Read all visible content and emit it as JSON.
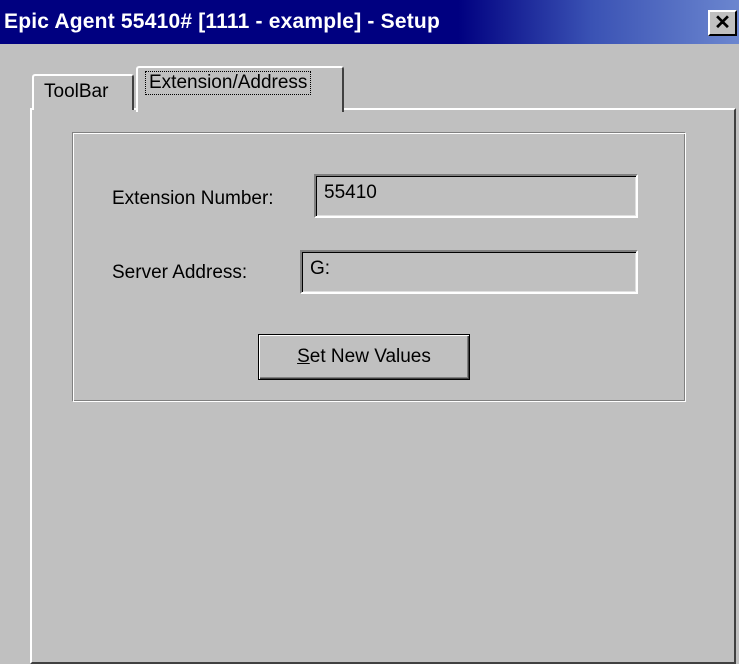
{
  "window": {
    "title": "Epic Agent 55410# [1111 - example] - Setup",
    "close_icon": "close-icon",
    "colors": {
      "titlebar": "#000080",
      "face": "#c0c0c0"
    }
  },
  "tabs": [
    {
      "label": "ToolBar",
      "selected": false
    },
    {
      "label": "Extension/Address",
      "selected": true
    }
  ],
  "form": {
    "extension_label": "Extension Number:",
    "extension_value": "55410",
    "server_label": "Server Address:",
    "server_value": "G:",
    "set_button_mnemonic": "S",
    "set_button_rest": "et New Values"
  }
}
